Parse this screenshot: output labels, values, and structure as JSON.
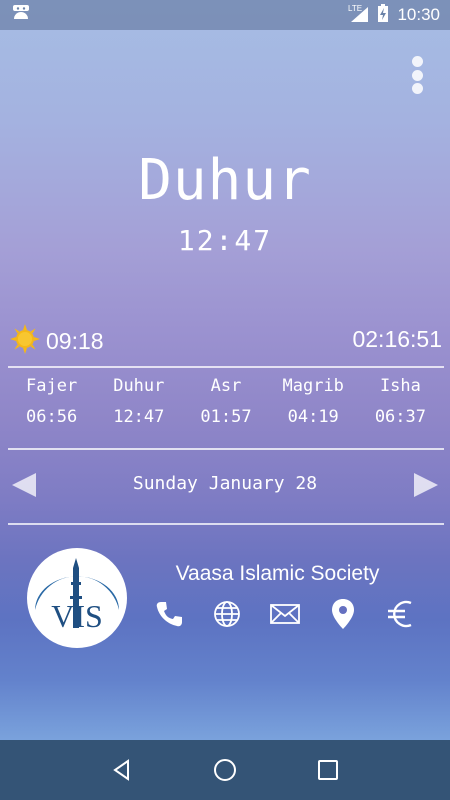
{
  "status_bar": {
    "network": "LTE",
    "time": "10:30"
  },
  "current_prayer": {
    "name": "Duhur",
    "time": "12:47"
  },
  "sunrise_time": "09:18",
  "countdown": "02:16:51",
  "prayers": [
    {
      "name": "Fajer",
      "time": "06:56"
    },
    {
      "name": "Duhur",
      "time": "12:47"
    },
    {
      "name": "Asr",
      "time": "01:57"
    },
    {
      "name": "Magrib",
      "time": "04:19"
    },
    {
      "name": "Isha",
      "time": "06:37"
    }
  ],
  "date_label": "Sunday January 28",
  "organization": {
    "name": "Vaasa Islamic Society",
    "logo_text": "VIS"
  },
  "contact_icons": [
    "phone-icon",
    "globe-icon",
    "mail-icon",
    "location-pin-icon",
    "euro-icon"
  ],
  "colors": {
    "sun": "#f6b816",
    "logo_text": "#1f4f82",
    "logo_arc": "#2b6aa6"
  }
}
